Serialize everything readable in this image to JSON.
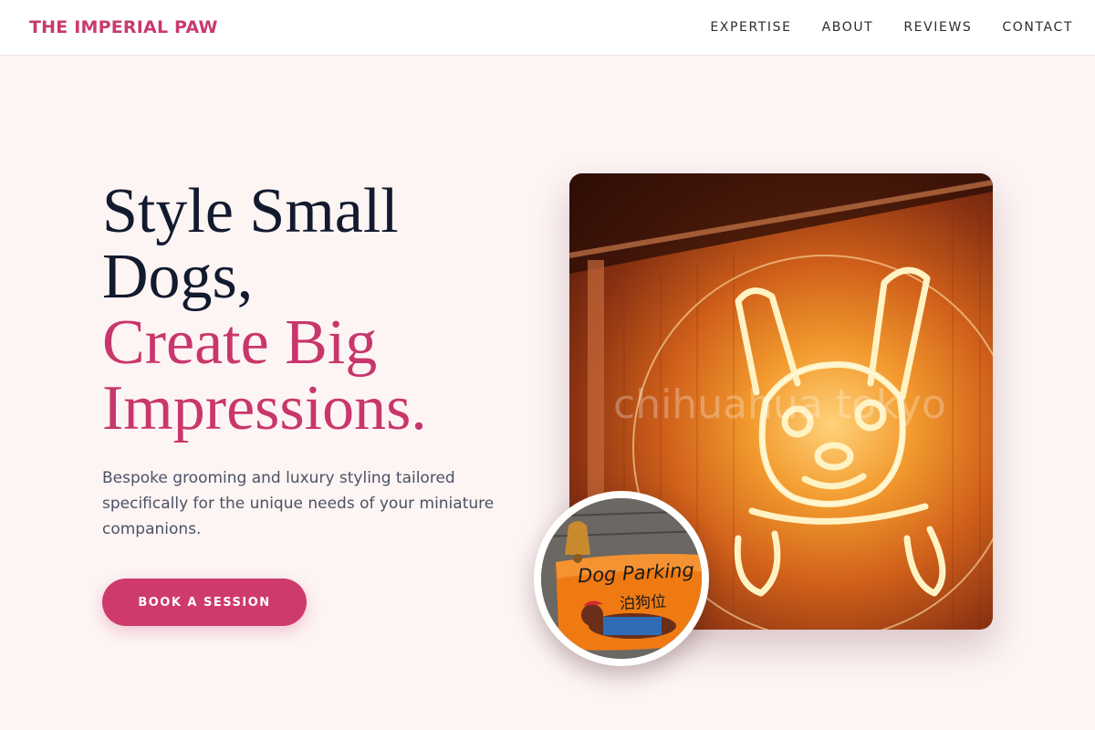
{
  "brand": {
    "name": "THE IMPERIAL PAW"
  },
  "nav": {
    "items": [
      {
        "label": "EXPERTISE"
      },
      {
        "label": "ABOUT"
      },
      {
        "label": "REVIEWS"
      },
      {
        "label": "CONTACT"
      }
    ]
  },
  "hero": {
    "headline_line1": "Style Small",
    "headline_line2": "Dogs,",
    "headline_accent1": "Create Big",
    "headline_accent2": "Impressions.",
    "subtext": "Bespoke grooming and luxury styling tailored specifically for the unique needs of your miniature companions.",
    "cta_label": "BOOK A SESSION"
  },
  "images": {
    "main_watermark": "chihuahua tokyo",
    "inset_sign_text": "Dog Parking",
    "inset_sign_kanji": "泊狗位"
  },
  "colors": {
    "brand_accent": "#c8376b",
    "background": "#fdf4f4",
    "headline": "#121a2e"
  }
}
